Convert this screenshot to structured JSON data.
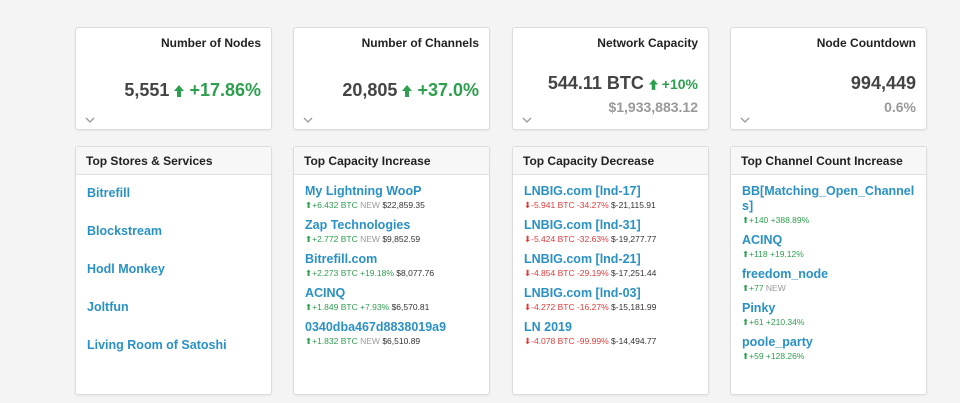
{
  "stats": [
    {
      "title": "Number of Nodes",
      "value": "5,551",
      "change": "+17.86%",
      "sub": ""
    },
    {
      "title": "Number of Channels",
      "value": "20,805",
      "change": "+37.0%",
      "sub": ""
    },
    {
      "title": "Network Capacity",
      "value": "544.11 BTC",
      "change": "+10%",
      "sub": "$1,933,883.12"
    },
    {
      "title": "Node Countdown",
      "value": "994,449",
      "change": "",
      "sub": "0.6%"
    }
  ],
  "stores": {
    "title": "Top Stores & Services",
    "items": [
      "Bitrefill",
      "Blockstream",
      "Hodl Monkey",
      "Joltfun",
      "Living Room of Satoshi"
    ]
  },
  "capacity_increase": {
    "title": "Top Capacity Increase",
    "items": [
      {
        "name": "My Lightning WooP",
        "btc": "+6.432 BTC",
        "pct": "NEW",
        "usd": "$22,859.35"
      },
      {
        "name": "Zap Technologies",
        "btc": "+2.772 BTC",
        "pct": "NEW",
        "usd": "$9,852.59"
      },
      {
        "name": "Bitrefill.com",
        "btc": "+2.273 BTC",
        "pct": "+19.18%",
        "usd": "$8,077.76"
      },
      {
        "name": "ACINQ",
        "btc": "+1.849 BTC",
        "pct": "+7.93%",
        "usd": "$6,570.81"
      },
      {
        "name": "0340dba467d8838019a9",
        "btc": "+1.832 BTC",
        "pct": "NEW",
        "usd": "$6,510.89"
      }
    ]
  },
  "capacity_decrease": {
    "title": "Top Capacity Decrease",
    "items": [
      {
        "name": "LNBIG.com [lnd-17]",
        "btc": "-5.941 BTC",
        "pct": "-34.27%",
        "usd": "$-21,115.91"
      },
      {
        "name": "LNBIG.com [lnd-31]",
        "btc": "-5.424 BTC",
        "pct": "-32.63%",
        "usd": "$-19,277.77"
      },
      {
        "name": "LNBIG.com [lnd-21]",
        "btc": "-4.854 BTC",
        "pct": "-29.19%",
        "usd": "$-17,251.44"
      },
      {
        "name": "LNBIG.com [lnd-03]",
        "btc": "-4.272 BTC",
        "pct": "-16.27%",
        "usd": "$-15,181.99"
      },
      {
        "name": "LN 2019",
        "btc": "-4.078 BTC",
        "pct": "-99.99%",
        "usd": "$-14,494.77"
      }
    ]
  },
  "channel_increase": {
    "title": "Top Channel Count Increase",
    "items": [
      {
        "name": "BB[Matching_Open_Channels]",
        "count": "+140",
        "pct": "+388.89%"
      },
      {
        "name": "ACINQ",
        "count": "+118",
        "pct": "+19.12%"
      },
      {
        "name": "freedom_node",
        "count": "+77",
        "pct": "NEW"
      },
      {
        "name": "Pinky",
        "count": "+61",
        "pct": "+210.34%"
      },
      {
        "name": "poole_party",
        "count": "+59",
        "pct": "+128.26%"
      }
    ]
  },
  "colors": {
    "link": "#2a91c5",
    "up": "#2e9e4f",
    "down": "#e03b3b",
    "muted": "#999999"
  }
}
